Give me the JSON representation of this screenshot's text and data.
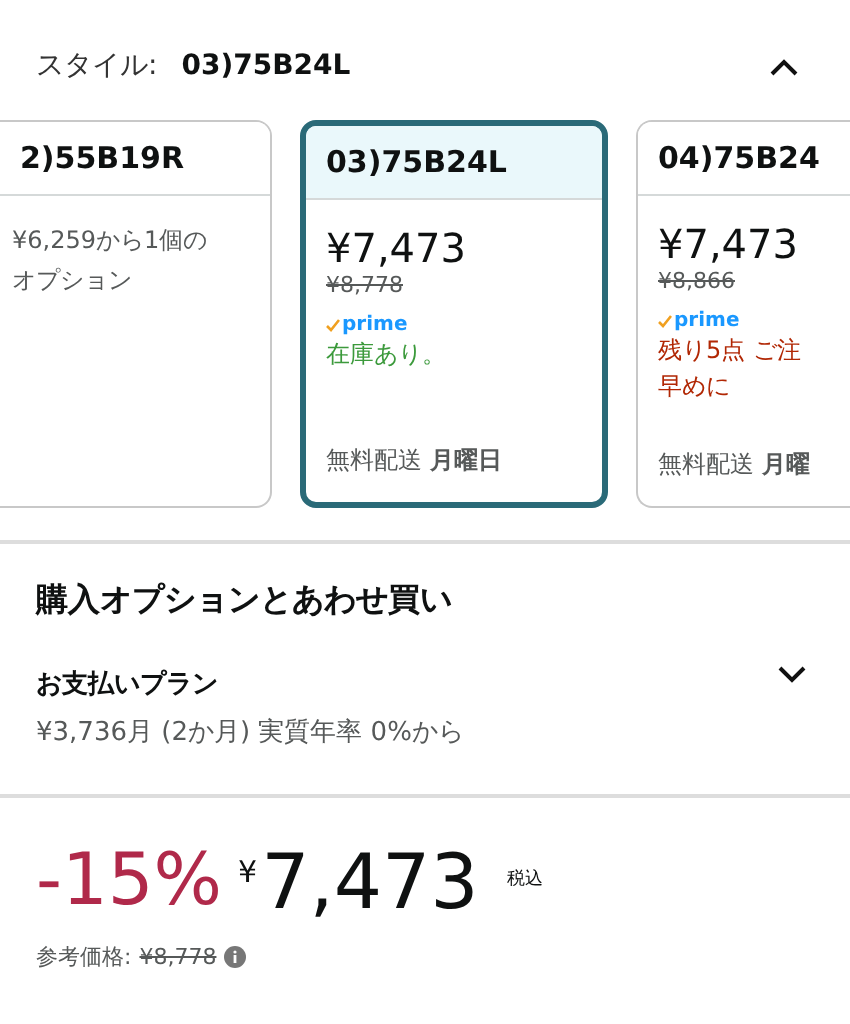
{
  "style_selector": {
    "label": "スタイル:",
    "value": "03)75B24L",
    "expanded": true
  },
  "options": [
    {
      "name": "2)55B19R",
      "selected": false,
      "price": "¥6,259から1個の",
      "price_line2": "オプション"
    },
    {
      "name": "03)75B24L",
      "selected": true,
      "price": "¥7,473",
      "list_price": "¥8,778",
      "prime": "prime",
      "stock": "在庫あり。",
      "kind": "in",
      "shipping": "無料配送",
      "day": "月曜日"
    },
    {
      "name": "04)75B24",
      "selected": false,
      "price": "¥7,473",
      "list_price": "¥8,866",
      "prime": "prime",
      "stock": "残り5点 ご注",
      "stock_line2": "早めに",
      "kind": "low",
      "shipping": "無料配送",
      "day": "月曜"
    }
  ],
  "section_title": "購入オプションとあわせ買い",
  "payment_plan": {
    "title": "お支払いプラン",
    "detail": "¥3,736月 (2か月) 実質年率 0%から",
    "expanded": false
  },
  "price": {
    "discount": "-15%",
    "currency": "¥",
    "amount": "7,473",
    "tax": "税込",
    "reference_label": "参考価格:",
    "reference_price": "¥8,778"
  }
}
